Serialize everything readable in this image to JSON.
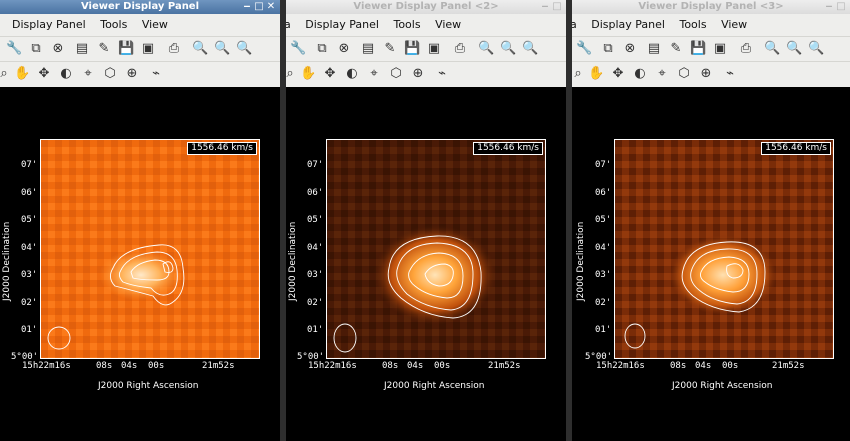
{
  "windows": [
    {
      "title": "Viewer Display Panel",
      "menus": [
        "Display Panel",
        "Tools",
        "View"
      ],
      "velocity": "1556.46 km/s"
    },
    {
      "title": "Viewer Display Panel <2>",
      "menus": [
        "a",
        "Display Panel",
        "Tools",
        "View"
      ],
      "velocity": "1556.46 km/s"
    },
    {
      "title": "Viewer Display Panel <3>",
      "menus": [
        "a",
        "Display Panel",
        "Tools",
        "View"
      ],
      "velocity": "1556.46 km/s"
    }
  ],
  "axes": {
    "ylabel": "J2000 Declination",
    "xlabel": "J2000 Right Ascension",
    "yticks": [
      "07'",
      "06'",
      "05'",
      "04'",
      "03'",
      "02'",
      "01'",
      "5°00'"
    ],
    "xticks": [
      "15h22m16s",
      "08s",
      "04s",
      "00s",
      "21m52s"
    ]
  },
  "colors": {
    "title_active": "#4a73a2",
    "toolbar_bg": "#eeeeec",
    "canvas_bg": "#000000"
  }
}
